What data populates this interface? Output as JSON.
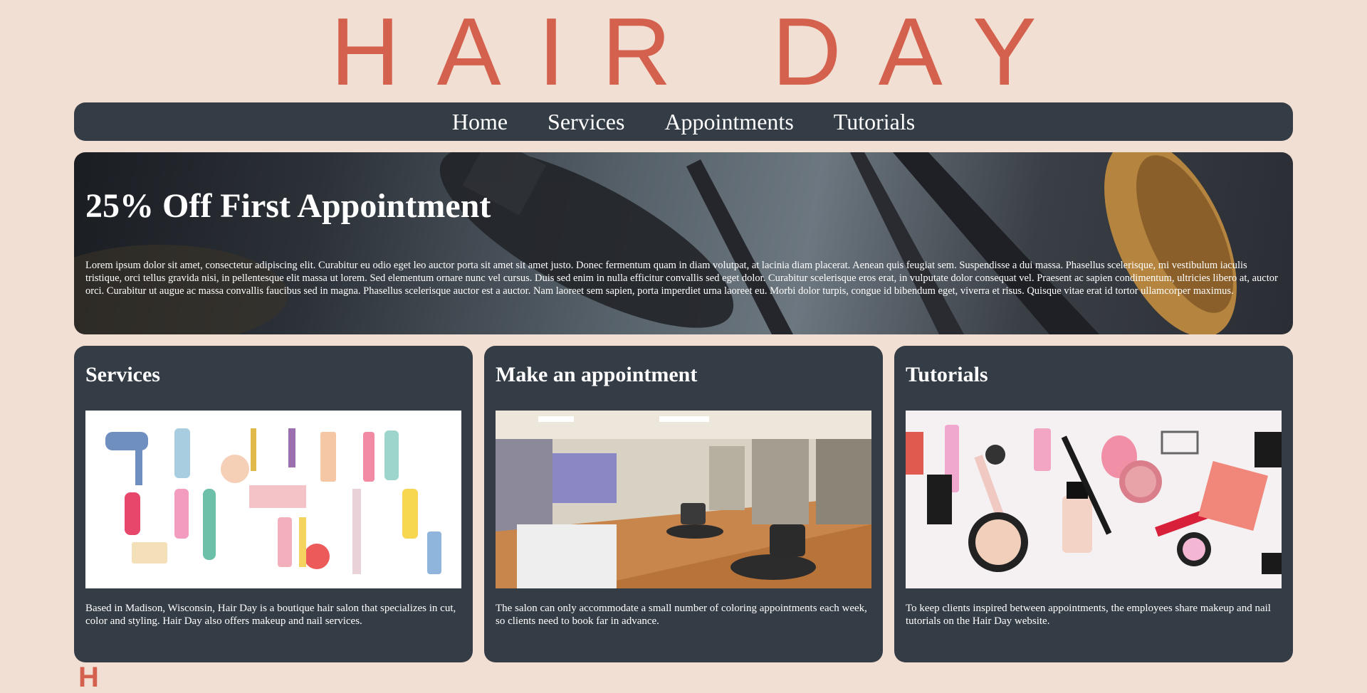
{
  "site": {
    "title": "HAIR DAY"
  },
  "nav": {
    "items": [
      "Home",
      "Services",
      "Appointments",
      "Tutorials"
    ]
  },
  "hero": {
    "title": "25% Off First Appointment",
    "body": "Lorem ipsum dolor sit amet, consectetur adipiscing elit. Curabitur eu odio eget leo auctor porta sit amet sit amet justo. Donec fermentum quam in diam volutpat, at lacinia diam placerat. Aenean quis feugiat sem. Suspendisse a dui massa. Phasellus scelerisque, mi vestibulum iaculis tristique, orci tellus gravida nisi, in pellentesque elit massa ut lorem. Sed elementum ornare nunc vel cursus. Duis sed enim in nulla efficitur convallis sed eget dolor. Curabitur scelerisque eros erat, in vulputate dolor consequat vel. Praesent ac sapien condimentum, ultricies libero at, auctor orci. Curabitur ut augue ac massa convallis faucibus sed in magna. Phasellus scelerisque auctor est a auctor. Nam laoreet sem sapien, porta imperdiet urna laoreet eu. Morbi dolor turpis, congue id bibendum eget, viverra et risus. Quisque vitae erat id tortor ullamcorper maximus."
  },
  "cards": [
    {
      "title": "Services",
      "text": "Based in Madison, Wisconsin, Hair Day is a boutique hair salon that specializes in cut, color and styling. Hair Day also offers makeup and nail services."
    },
    {
      "title": "Make an appointment",
      "text": "The salon can only accommodate a small number of coloring appointments each week, so clients need to book far in advance."
    },
    {
      "title": "Tutorials",
      "text": "To keep clients inspired between appointments, the employees share makeup and nail tutorials on the Hair Day website."
    }
  ],
  "footer": {
    "peek": "H"
  },
  "colors": {
    "accent": "#d4614e",
    "panel": "#343c46",
    "background": "#f2dfd3"
  }
}
